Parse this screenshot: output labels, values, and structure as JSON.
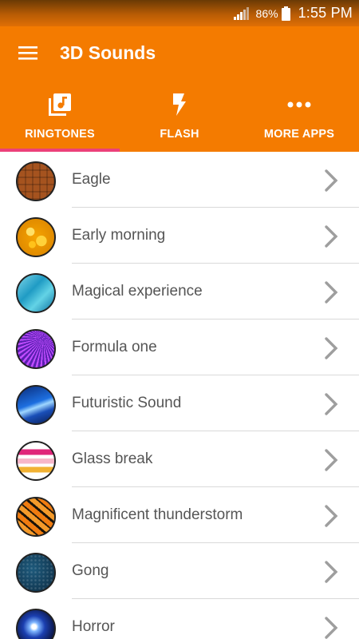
{
  "status_bar": {
    "battery_percent": "86%",
    "time": "1:55 PM"
  },
  "app_bar": {
    "title": "3D Sounds"
  },
  "tabs": [
    {
      "label": "RINGTONES",
      "icon": "music-library-icon",
      "selected": true
    },
    {
      "label": "FLASH",
      "icon": "flash-icon",
      "selected": false
    },
    {
      "label": "MORE APPS",
      "icon": "more-dots-icon",
      "selected": false
    }
  ],
  "colors": {
    "primary": "#f47b00",
    "indicator": "#ec407a",
    "text": "#555555",
    "chevron": "#9e9e9e"
  },
  "ringtones": [
    {
      "name": "Eagle"
    },
    {
      "name": "Early morning"
    },
    {
      "name": "Magical experience"
    },
    {
      "name": "Formula one"
    },
    {
      "name": "Futuristic Sound"
    },
    {
      "name": "Glass break"
    },
    {
      "name": "Magnificent thunderstorm"
    },
    {
      "name": "Gong"
    },
    {
      "name": "Horror"
    }
  ]
}
